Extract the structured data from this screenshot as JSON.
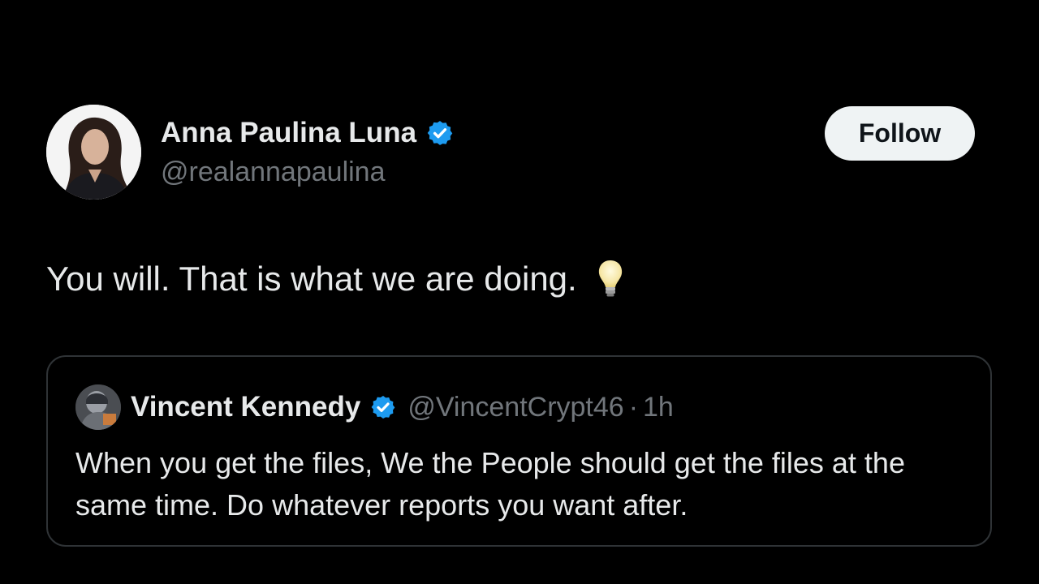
{
  "tweet": {
    "author_name": "Anna Paulina Luna",
    "author_handle": "@realannapaulina",
    "follow_label": "Follow",
    "text": "You will. That is what we are doing.",
    "emoji_icon": "light-bulb-icon"
  },
  "quote": {
    "author_name": "Vincent Kennedy",
    "author_handle": "@VincentCrypt46",
    "separator": "·",
    "time": "1h",
    "text": "When you get the files, We the People should get the files at the same time. Do whatever reports you want after."
  },
  "colors": {
    "background": "#000000",
    "primary_text": "#e7e9ea",
    "secondary_text": "#71767b",
    "verified_blue": "#1d9bf0",
    "follow_button_bg": "#eff3f4",
    "card_border": "#2f3336"
  }
}
